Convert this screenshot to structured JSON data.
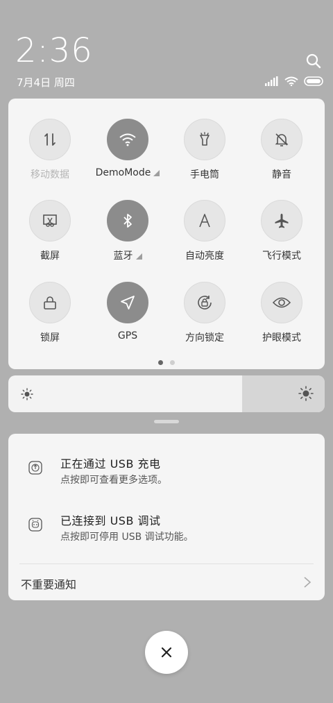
{
  "status": {
    "time": "2:36",
    "date": "7月4日 周四"
  },
  "quick_settings": {
    "tiles": [
      {
        "label": "移动数据",
        "icon": "mobile-data-icon",
        "active": false,
        "dim": true
      },
      {
        "label": "DemoMode",
        "icon": "wifi-icon",
        "active": true,
        "expand": true
      },
      {
        "label": "手电筒",
        "icon": "flashlight-icon",
        "active": false
      },
      {
        "label": "静音",
        "icon": "bell-mute-icon",
        "active": false
      },
      {
        "label": "截屏",
        "icon": "screenshot-icon",
        "active": false
      },
      {
        "label": "蓝牙",
        "icon": "bluetooth-icon",
        "active": true,
        "expand": true
      },
      {
        "label": "自动亮度",
        "icon": "auto-brightness-icon",
        "active": false
      },
      {
        "label": "飞行模式",
        "icon": "airplane-icon",
        "active": false
      },
      {
        "label": "锁屏",
        "icon": "lock-icon",
        "active": false
      },
      {
        "label": "GPS",
        "icon": "gps-icon",
        "active": true
      },
      {
        "label": "方向锁定",
        "icon": "rotation-lock-icon",
        "active": false
      },
      {
        "label": "护眼模式",
        "icon": "eye-icon",
        "active": false
      }
    ],
    "page_count": 2,
    "current_page": 1
  },
  "brightness": {
    "level": 0.74
  },
  "notifications": [
    {
      "title": "正在通过 USB 充电",
      "subtitle": "点按即可查看更多选项。",
      "icon": "usb-charge-icon"
    },
    {
      "title": "已连接到 USB 调试",
      "subtitle": "点按即可停用 USB 调试功能。",
      "icon": "usb-debug-icon"
    }
  ],
  "unimportant_label": "不重要通知",
  "colors": {
    "active_tile": "#8c8c8c",
    "panel": "#f5f5f5",
    "background": "#b0b0b0"
  }
}
